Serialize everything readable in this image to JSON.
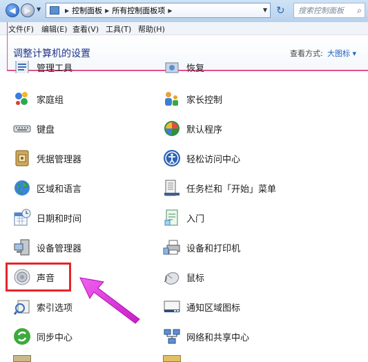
{
  "address_bar": {
    "crumbs": [
      "控制面板",
      "所有控制面板项"
    ],
    "search_placeholder": "搜索控制面板"
  },
  "menu": {
    "file": "文件(F)",
    "edit": "编辑(E)",
    "view": "查看(V)",
    "tools": "工具(T)",
    "help": "帮助(H)"
  },
  "header": {
    "title": "调整计算机的设置",
    "view_by_label": "查看方式:",
    "view_by_value": "大图标 ▾"
  },
  "partial_row": {
    "left": "管理工具",
    "right": "恢复"
  },
  "items_left": [
    {
      "label": "家庭组",
      "icon": "homegroup-icon"
    },
    {
      "label": "键盘",
      "icon": "keyboard-icon"
    },
    {
      "label": "凭据管理器",
      "icon": "credential-manager-icon"
    },
    {
      "label": "区域和语言",
      "icon": "globe-icon"
    },
    {
      "label": "日期和时间",
      "icon": "calendar-clock-icon"
    },
    {
      "label": "设备管理器",
      "icon": "device-manager-icon"
    },
    {
      "label": "声音",
      "icon": "speaker-icon"
    },
    {
      "label": "索引选项",
      "icon": "index-options-icon"
    },
    {
      "label": "同步中心",
      "icon": "sync-center-icon"
    }
  ],
  "items_right": [
    {
      "label": "家长控制",
      "icon": "parental-controls-icon"
    },
    {
      "label": "默认程序",
      "icon": "default-programs-icon"
    },
    {
      "label": "轻松访问中心",
      "icon": "ease-of-access-icon"
    },
    {
      "label": "任务栏和「开始」菜单",
      "icon": "taskbar-icon"
    },
    {
      "label": "入门",
      "icon": "getting-started-icon"
    },
    {
      "label": "设备和打印机",
      "icon": "printer-icon"
    },
    {
      "label": "鼠标",
      "icon": "mouse-icon"
    },
    {
      "label": "通知区域图标",
      "icon": "notification-area-icon"
    },
    {
      "label": "网络和共享中心",
      "icon": "network-sharing-icon"
    }
  ],
  "annotation": {
    "highlight_color": "#e5252a",
    "arrow_color": "#e040e0"
  }
}
